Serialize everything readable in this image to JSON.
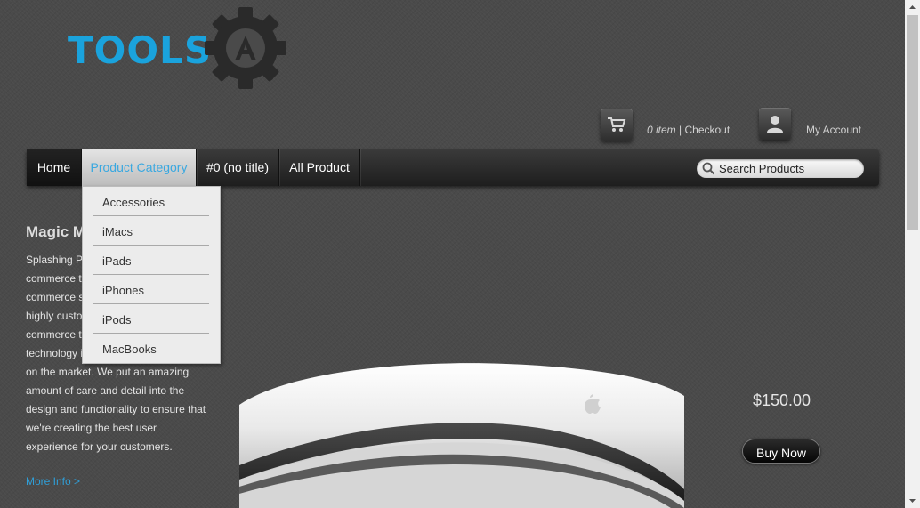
{
  "logo": {
    "text": "TOOLS",
    "gear_letter": "A",
    "color": "#1aa3dd",
    "gear_color": "#2a2a2a"
  },
  "header": {
    "cart_icon": "shopping-cart-icon",
    "cart_count": "0 item",
    "cart_separator": " | ",
    "checkout_label": "Checkout",
    "account_icon": "user-icon",
    "account_label": "My Account"
  },
  "nav": {
    "items": [
      {
        "label": "Home"
      },
      {
        "label": "Product Category",
        "active": true
      },
      {
        "label": "#0 (no title)"
      },
      {
        "label": "All Product"
      }
    ],
    "search": {
      "placeholder": "Search Products",
      "icon": "search-icon"
    }
  },
  "dropdown": {
    "items": [
      "Accessories",
      "iMacs",
      "iPads",
      "iPhones",
      "iPods",
      "MacBooks"
    ]
  },
  "product": {
    "title": "Magic Mouse",
    "description": "Splashing Pixels WordPress e-commerce theme is the best e-commerce solution on the planet. Our highly customisable WordPress e-commerce theme and advanced technology is unlike any other theme on the market. We put an amazing amount of care and detail into the design and functionality to ensure that we're creating the best user experience for your customers.",
    "more_info": "More Info >",
    "price": "$150.00",
    "buy_label": "Buy Now"
  },
  "colors": {
    "background": "#4a4a4a",
    "accent": "#1aa3dd",
    "link": "#2f9fd8"
  }
}
